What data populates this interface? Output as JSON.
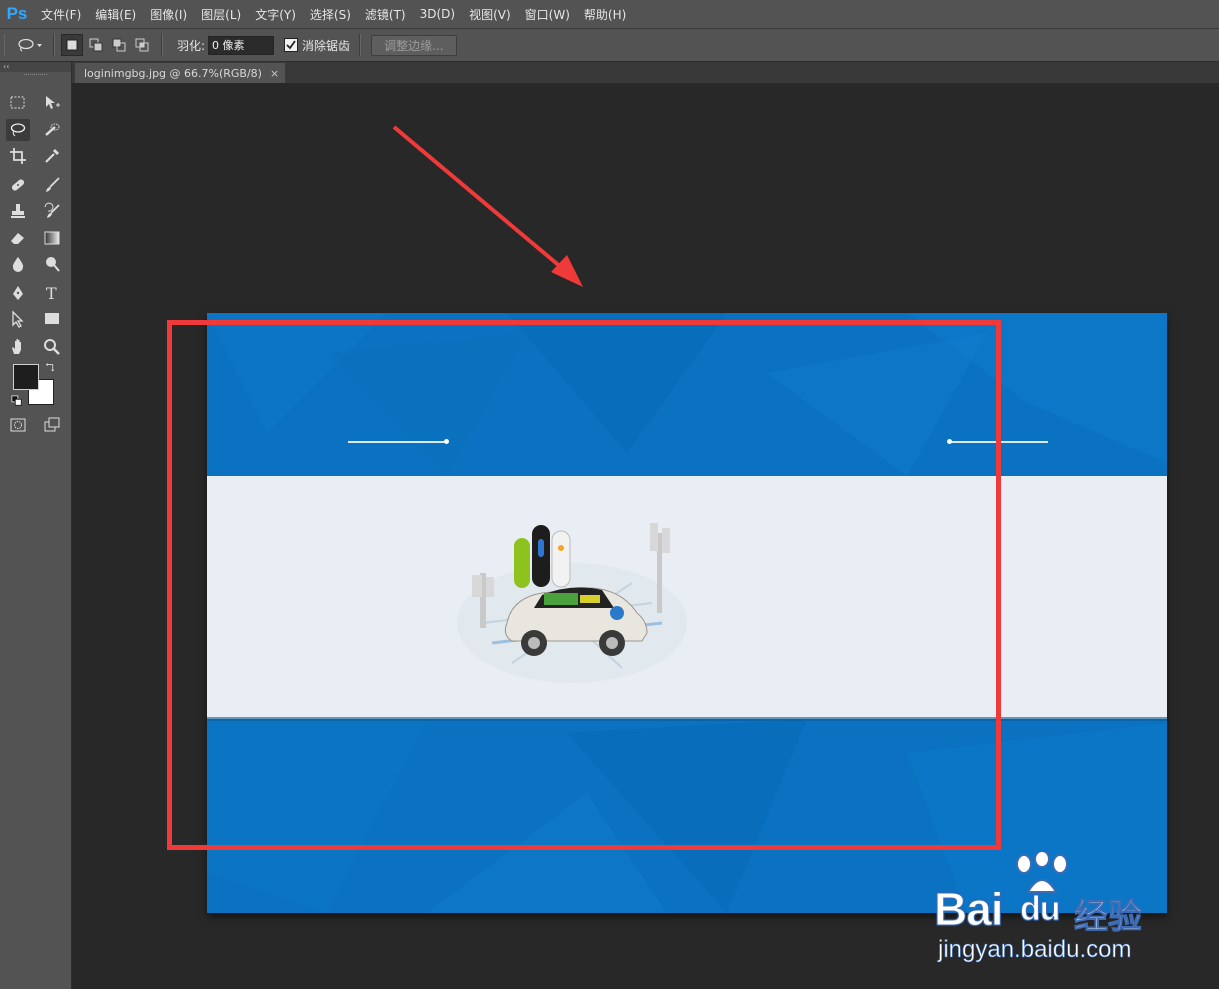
{
  "app": {
    "logo": "Ps"
  },
  "menu": [
    "文件(F)",
    "编辑(E)",
    "图像(I)",
    "图层(L)",
    "文字(Y)",
    "选择(S)",
    "滤镜(T)",
    "3D(D)",
    "视图(V)",
    "窗口(W)",
    "帮助(H)"
  ],
  "options": {
    "feather_label": "羽化:",
    "feather_value": "0 像素",
    "antialias_label": "消除锯齿",
    "antialias_checked": true,
    "refine_edge_label": "调整边缘..."
  },
  "toolpanel": {
    "collapse_glyph": "‹‹"
  },
  "document": {
    "tab_title": "loginimgbg.jpg @ 66.7%(RGB/8)",
    "close_glyph": "×"
  },
  "colors": {
    "canvas_blue": "#0a72c1",
    "band": "#e9eef4",
    "selection_red": "#f03a3a",
    "foreground": "#1e1e1e",
    "background": "#ffffff"
  },
  "watermark": {
    "logo_text": "Bai",
    "logo_suffix": "du",
    "brand": "经验",
    "url": "jingyan.baidu.com"
  }
}
